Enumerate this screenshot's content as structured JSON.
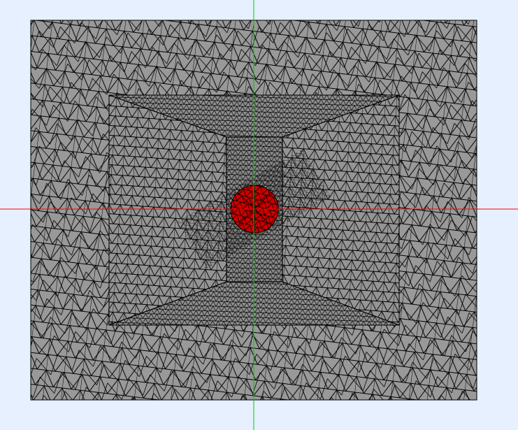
{
  "viewport": {
    "background": "#e6f0ff"
  },
  "axes": {
    "x_axis_color": "#ff0000",
    "y_axis_color": "#00cc00"
  },
  "mesh": {
    "outer_domain_fill": "#999999",
    "inner_block_fill": "#909090",
    "edge_color": "#000000",
    "inclusion_fill": "#cc0000",
    "inclusion_shape": "circle",
    "element_type": "triangular",
    "regions": [
      "outer-domain",
      "refined-box",
      "refined-core",
      "circular-inclusion"
    ]
  }
}
